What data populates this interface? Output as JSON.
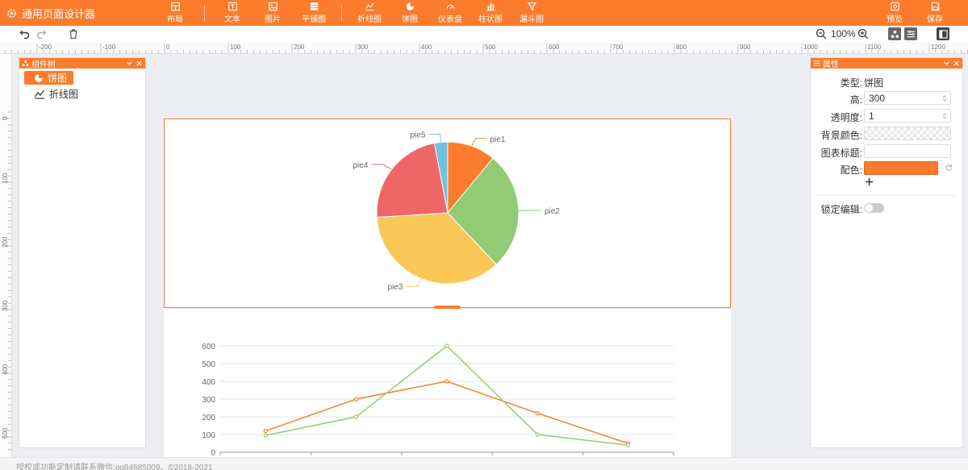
{
  "app": {
    "title": "通用页面设计器",
    "footer": "授权或功能定制请联系微信:qq84685009。©2018-2021"
  },
  "toolbar": {
    "buttons": [
      {
        "label": "布局",
        "icon": "layout-icon"
      },
      {
        "label": "文本",
        "icon": "text-icon"
      },
      {
        "label": "图片",
        "icon": "image-icon"
      },
      {
        "label": "平铺图",
        "icon": "tile-icon"
      },
      {
        "label": "折线图",
        "icon": "line-chart-icon"
      },
      {
        "label": "饼图",
        "icon": "pie-chart-icon"
      },
      {
        "label": "仪表盘",
        "icon": "gauge-icon"
      },
      {
        "label": "柱状图",
        "icon": "bar-chart-icon"
      },
      {
        "label": "漏斗图",
        "icon": "funnel-icon"
      }
    ],
    "right_buttons": [
      {
        "label": "预览",
        "icon": "preview-icon"
      },
      {
        "label": "保存",
        "icon": "save-icon"
      }
    ],
    "zoom": "100%"
  },
  "ruler": {
    "h_labels": [
      "-200",
      "-100",
      "0",
      "100",
      "200",
      "300",
      "400",
      "500",
      "600",
      "700",
      "800",
      "900",
      "1000",
      "1100",
      "1200"
    ],
    "v_labels": [
      "0",
      "100",
      "200",
      "300",
      "400",
      "500"
    ]
  },
  "tree": {
    "title": "组件树",
    "items": [
      {
        "label": "饼图",
        "icon": "pie-chart-icon",
        "active": true
      },
      {
        "label": "折线图",
        "icon": "line-chart-icon",
        "active": false
      }
    ]
  },
  "props": {
    "title": "属性",
    "type_label": "类型:",
    "type_value": "饼图",
    "height_label": "高:",
    "height_value": "300",
    "opacity_label": "透明度:",
    "opacity_value": "1",
    "bg_color_label": "背景颜色:",
    "chart_title_label": "图表标题:",
    "chart_title_value": "",
    "color_label": "配色:",
    "color_value": "#fd7b2c",
    "lock_label": "锁定编辑:",
    "lock_value": false
  },
  "colors": {
    "accent": "#fd7b2c",
    "pie1": "#fd7b2c",
    "pie2": "#91cb74",
    "pie3": "#fac858",
    "pie4": "#ee6666",
    "pie5": "#73c0de",
    "line1": "#fd7b2c",
    "line2": "#91cb74"
  },
  "chart_data": [
    {
      "type": "pie",
      "categories": [
        "pie1",
        "pie2",
        "pie3",
        "pie4",
        "pie5"
      ],
      "values": [
        11,
        27,
        36,
        23,
        3
      ]
    },
    {
      "type": "line",
      "categories": [
        "",
        "",
        "",
        "",
        ""
      ],
      "series": [
        {
          "values": [
            120,
            300,
            400,
            220,
            50
          ]
        },
        {
          "values": [
            95,
            200,
            600,
            100,
            40
          ]
        }
      ],
      "y_ticks": [
        "0",
        "100",
        "200",
        "300",
        "400",
        "500",
        "600"
      ],
      "ylim": [
        0,
        600
      ],
      "grid": true
    }
  ]
}
